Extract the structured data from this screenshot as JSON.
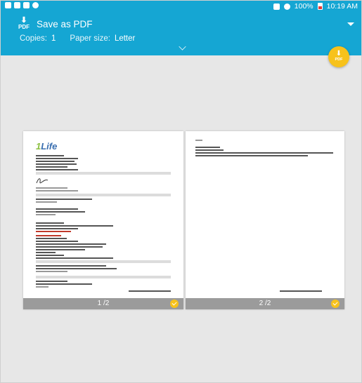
{
  "status_bar": {
    "time": "10:19 AM",
    "battery": "100%"
  },
  "toolbar": {
    "pdf_icon_label": "PDF",
    "title": "Save as PDF",
    "copies_label": "Copies:",
    "copies_value": "1",
    "paper_size_label": "Paper size:",
    "paper_size_value": "Letter"
  },
  "fab": {
    "label": "PDF"
  },
  "pages": [
    {
      "indicator": "1 /2"
    },
    {
      "indicator": "2 /2"
    }
  ]
}
